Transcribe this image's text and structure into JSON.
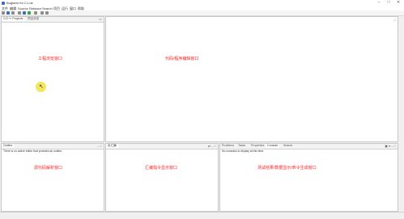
{
  "window": {
    "title": "Bugtarm for C-Lnk",
    "controls": [
      "–",
      "□",
      "✕"
    ]
  },
  "menubar": {
    "items": [
      "文件",
      "编辑",
      "Source",
      "Refactor",
      "Search",
      "项目",
      "运行",
      "窗口",
      "帮助"
    ]
  },
  "toolbar": {
    "icons": [
      "new-icon",
      "save-icon",
      "print-icon",
      "build-icon",
      "debug-icon",
      "run-icon",
      "search-icon",
      "back-icon",
      "forward-icon"
    ],
    "colors": {
      "blue": "#3b6fb6",
      "green": "#3aa341",
      "gray": "#8c8c8c"
    }
  },
  "project_panel": {
    "tabs": [
      "C/C++ Projects",
      "项目浏览"
    ],
    "label": "工程浏览窗口"
  },
  "editor_panel": {
    "label": "代码/程序编辑窗口"
  },
  "outline_panel": {
    "tab": "Outline",
    "message": "There is no active editor that provides an outline.",
    "label": "源代码解析窗口"
  },
  "disasm_panel": {
    "tab": "反汇编",
    "label": "汇编指令显示窗口"
  },
  "console_panel": {
    "tabs": [
      "Problems",
      "Tasks",
      "Properties",
      "Console",
      "Search"
    ],
    "message": "No consoles to display at this time.",
    "label": "测试结果/数据显示/命令生成窗口"
  },
  "colors": {
    "label_red": "#ff2020",
    "highlight_yellow": "#f3e34a"
  }
}
